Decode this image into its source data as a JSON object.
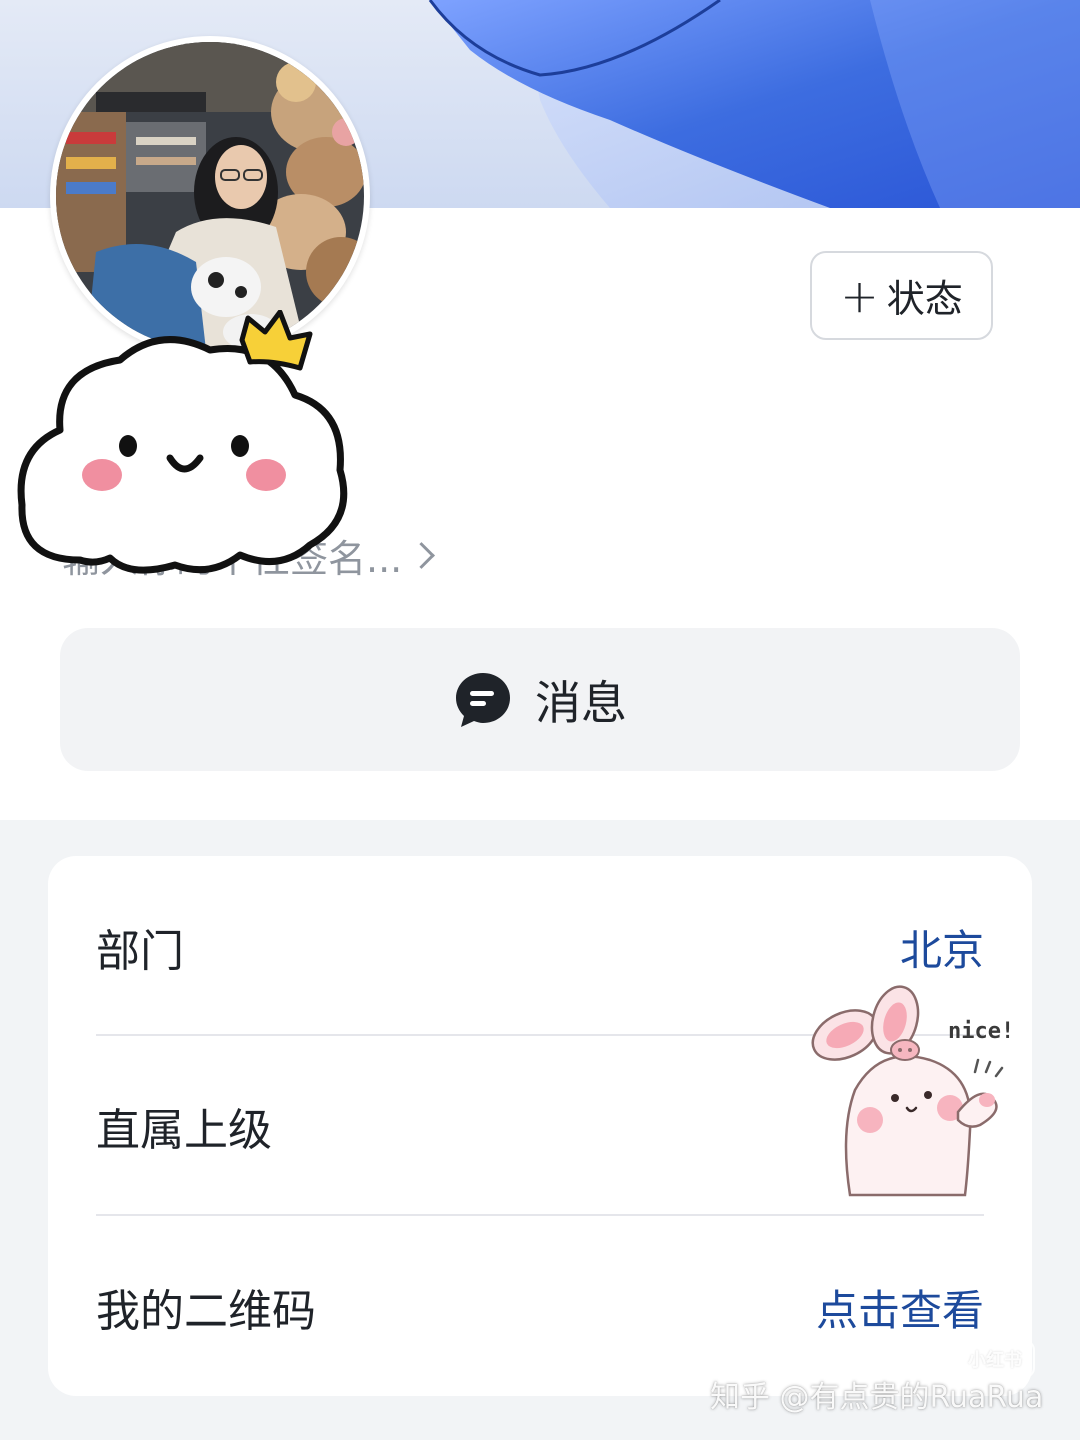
{
  "profile": {
    "status_button_label": "状态",
    "signature_placeholder": "输入你的个性签名...",
    "message_button_label": "消息"
  },
  "info": {
    "rows": [
      {
        "label": "部门",
        "value": "北京"
      },
      {
        "label": "直属上级",
        "value": ""
      },
      {
        "label": "我的二维码",
        "value": "点击查看"
      }
    ]
  },
  "stickers": {
    "bunny_text": "nice!"
  },
  "watermarks": {
    "app_badge": "小红书",
    "author": "知乎 @有点贵的RuaRua"
  },
  "colors": {
    "link_value": "#1d4a9c",
    "banner_accent": "#3d6de0",
    "card_background": "#ffffff",
    "page_background": "#f2f4f6"
  }
}
